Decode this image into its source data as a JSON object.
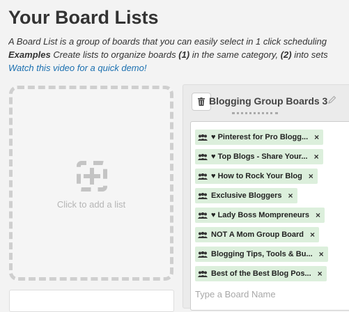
{
  "header": {
    "title": "Your Board Lists",
    "desc_line1": "A Board List is a group of boards that you can easily select in 1 click scheduling",
    "desc_line2_bold": "Examples",
    "desc_line2_a": " Create lists to organize boards ",
    "desc_line2_n1": "(1)",
    "desc_line2_b": " in the same category, ",
    "desc_line2_n2": "(2)",
    "desc_line2_c": " into sets",
    "demo_link": "Watch this video for a quick demo!"
  },
  "add_list": {
    "label": "Click to add a list",
    "icon": "add-square-icon"
  },
  "board_list": {
    "name": "Blogging Group Boards 3",
    "delete_icon": "trash-icon",
    "edit_icon": "pencil-icon",
    "boards": [
      {
        "label": "♥ Pinterest for Pro Blogg..."
      },
      {
        "label": "♥ Top Blogs - Share Your..."
      },
      {
        "label": "♥ How to Rock Your Blog"
      },
      {
        "label": "Exclusive Bloggers"
      },
      {
        "label": "♥ Lady Boss Mompreneurs"
      },
      {
        "label": "NOT A Mom Group Board"
      },
      {
        "label": "Blogging Tips, Tools & Bu..."
      },
      {
        "label": "Best of the Best Blog Pos..."
      }
    ],
    "remove_glyph": "×",
    "input_placeholder": "Type a Board Name"
  },
  "colors": {
    "accent_link": "#1a6fb0",
    "tag_bg": "#dcefdc"
  }
}
